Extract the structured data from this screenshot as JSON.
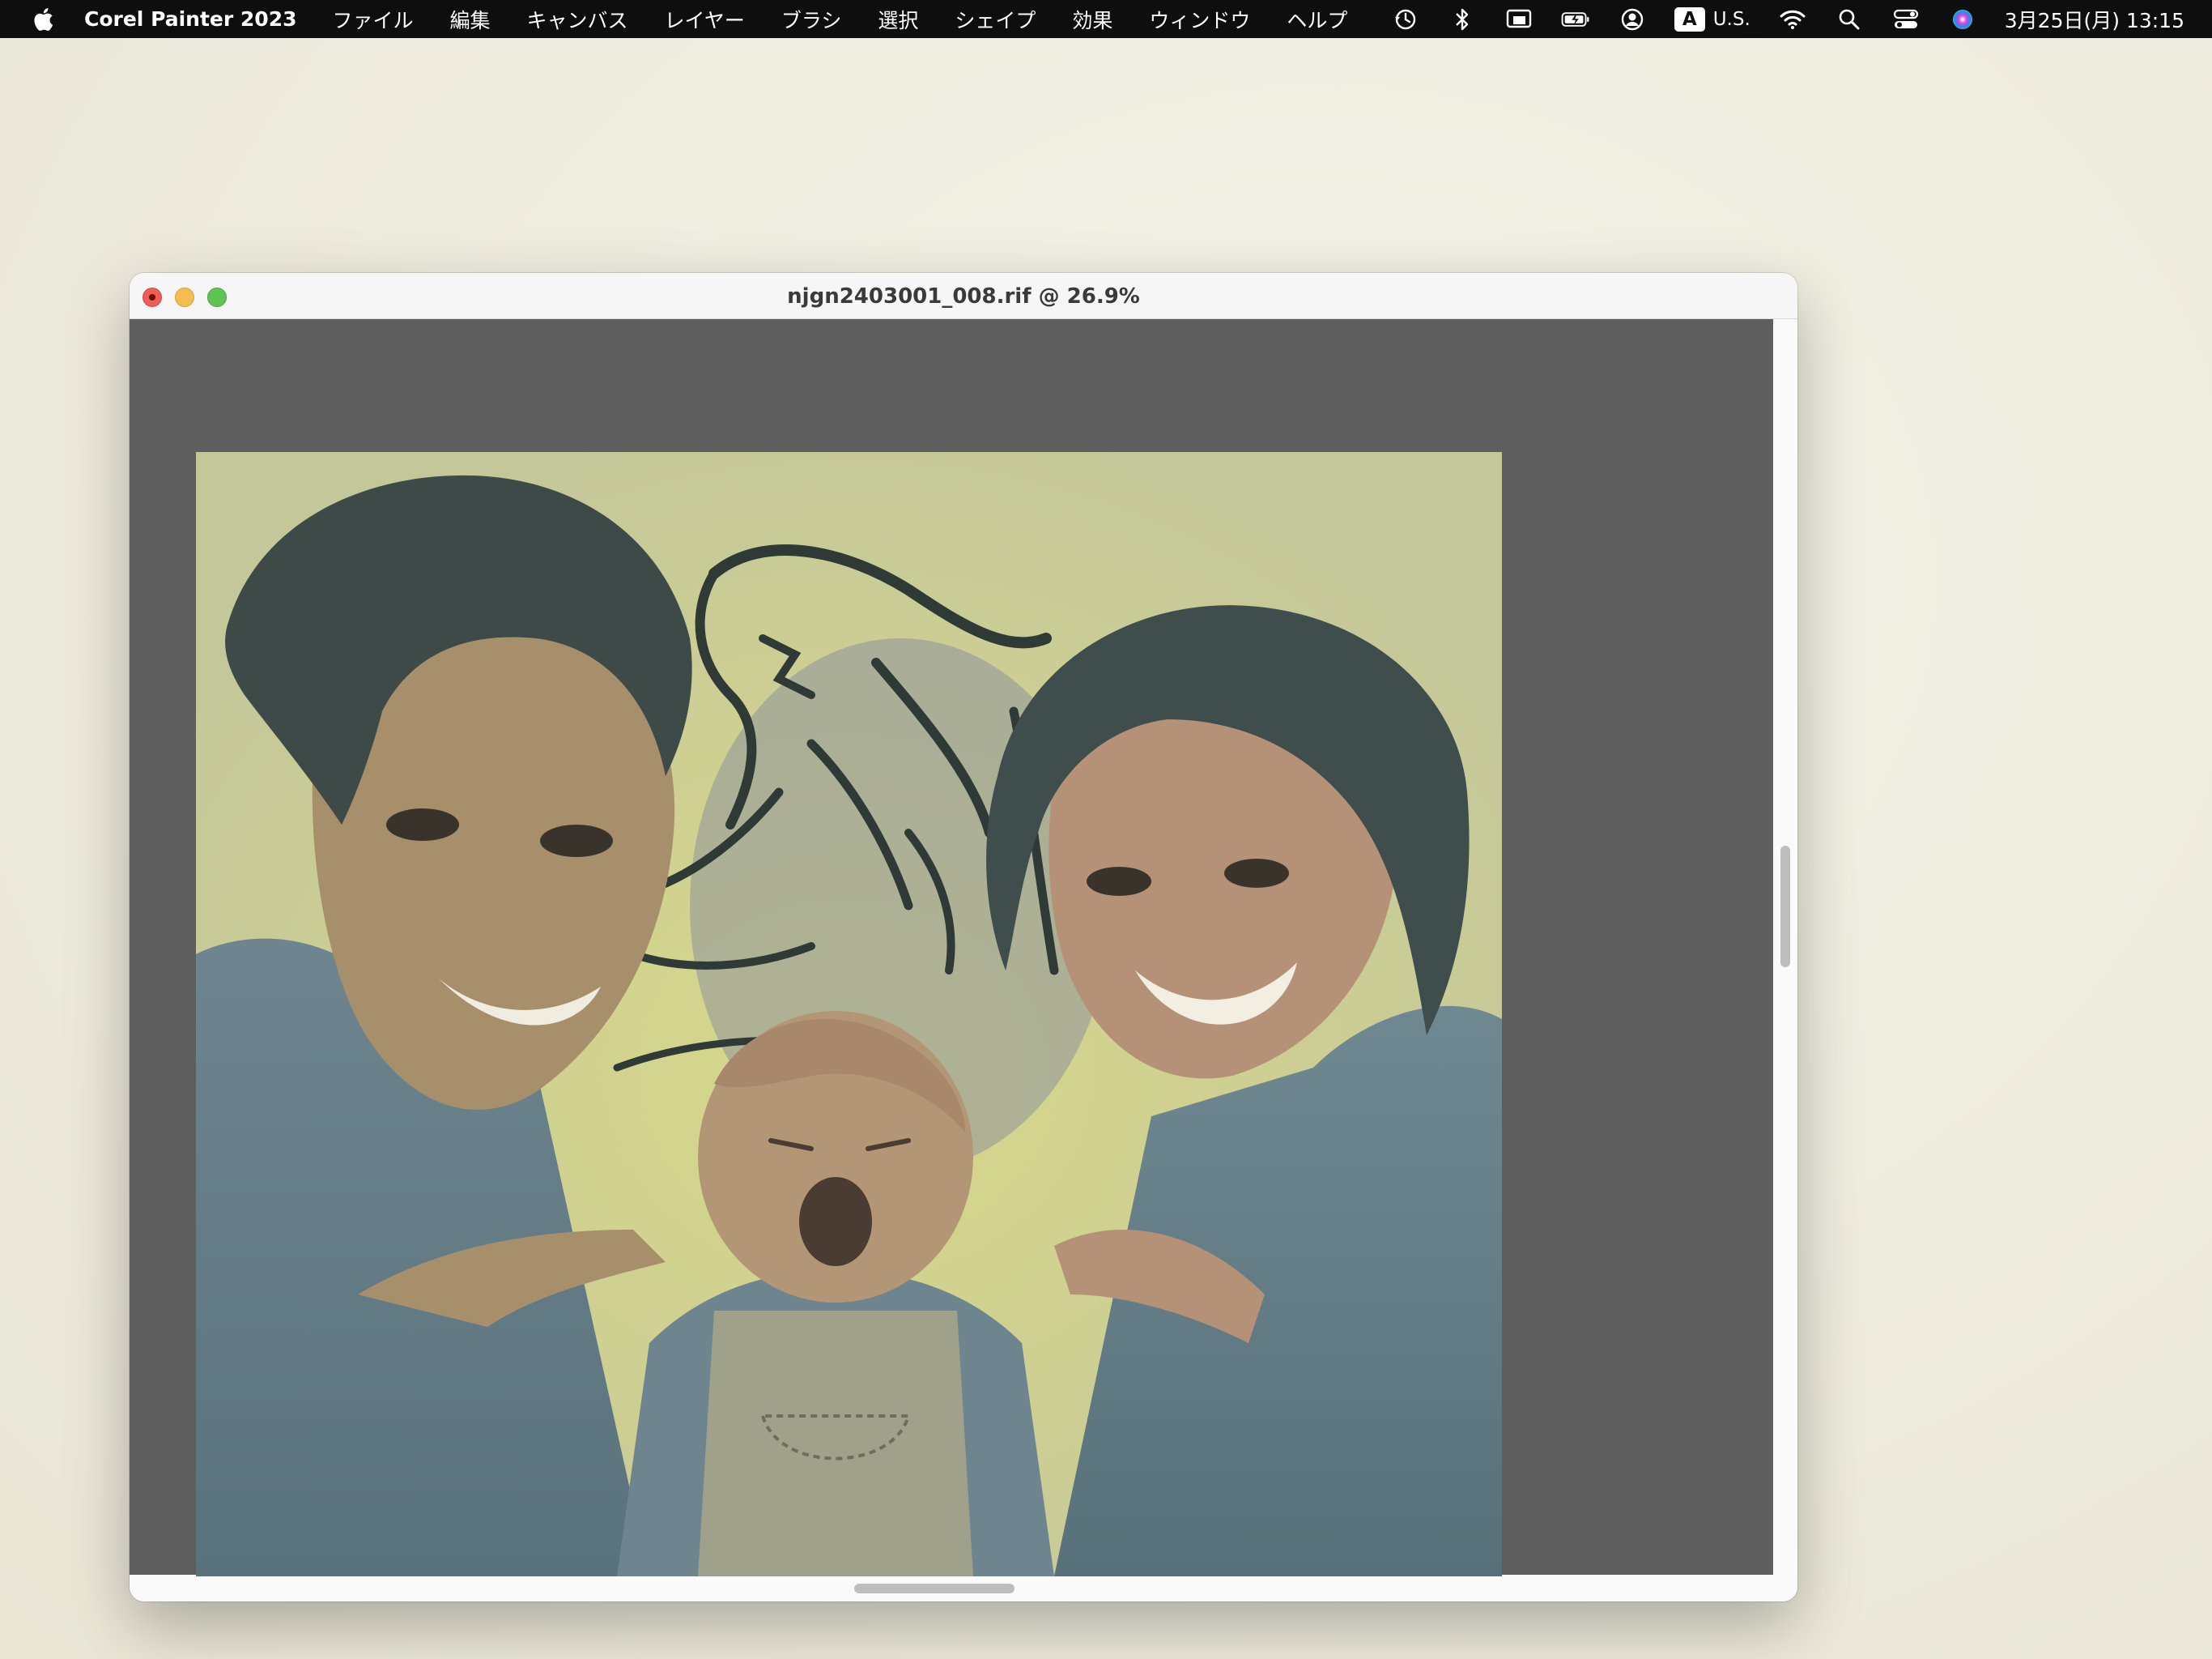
{
  "menubar": {
    "app_name": "Corel Painter 2023",
    "menus": [
      "ファイル",
      "編集",
      "キャンバス",
      "レイヤー",
      "ブラシ",
      "選択",
      "シェイプ",
      "効果",
      "ウィンドウ",
      "ヘルプ"
    ],
    "input_source_badge": "A",
    "input_source_label": "U.S.",
    "clock": "3月25日(月) 13:15"
  },
  "window": {
    "title": "njgn2403001_008.rif @ 26.9%"
  },
  "colors": {
    "menubar_bg": "#0e0e0e",
    "canvas_bg": "#5e5e5e",
    "artwork_bg": "#c6c99a"
  }
}
